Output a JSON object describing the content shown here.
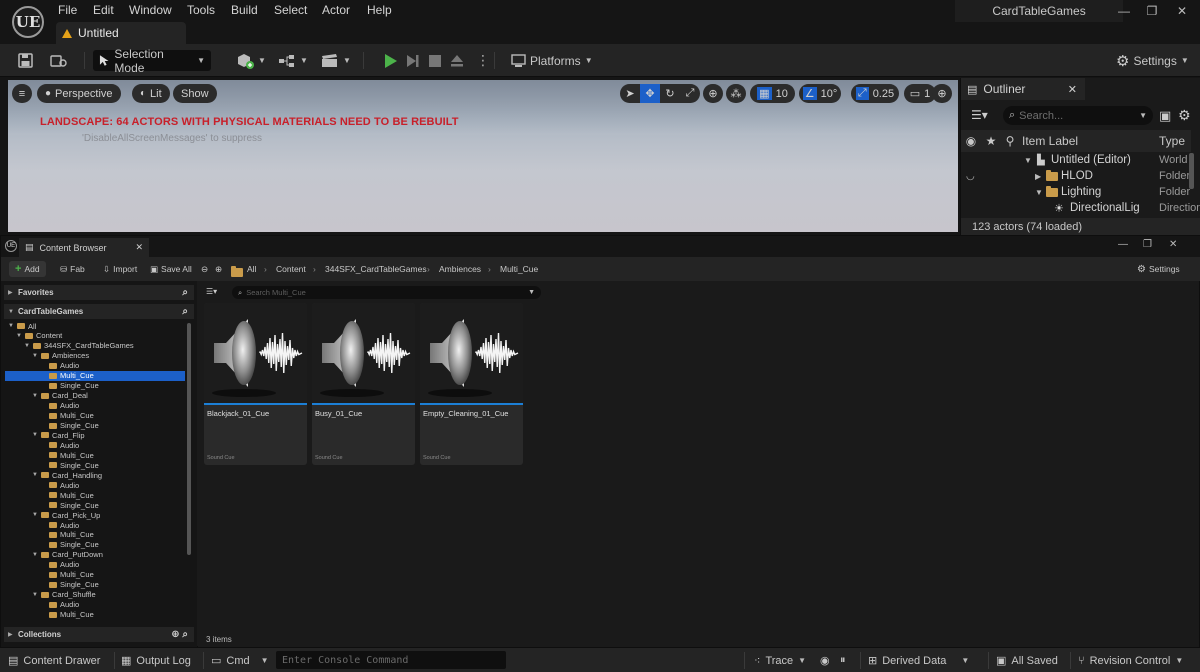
{
  "app": {
    "logo": "UE",
    "menu": [
      "File",
      "Edit",
      "Window",
      "Tools",
      "Build",
      "Select",
      "Actor",
      "Help"
    ],
    "document_tab": "Untitled",
    "project_name": "CardTableGames",
    "window_controls": {
      "minimize": "—",
      "maximize": "❐",
      "close": "✕"
    }
  },
  "toolbar": {
    "selection_mode": "Selection Mode",
    "platforms": "Platforms",
    "settings": "Settings"
  },
  "viewport": {
    "perspective": "Perspective",
    "lit": "Lit",
    "show": "Show",
    "grid_snap": "10",
    "rotation_snap": "10°",
    "scale_snap": "0.25",
    "camera_speed": "1",
    "warning": "LANDSCAPE: 64 ACTORS WITH PHYSICAL MATERIALS NEED TO BE REBUILT",
    "warning_hint": "'DisableAllScreenMessages' to suppress"
  },
  "outliner": {
    "tab": "Outliner",
    "search_placeholder": "Search...",
    "col_label": "Item Label",
    "col_type": "Type",
    "rows": [
      {
        "label": "Untitled (Editor)",
        "type": "World"
      },
      {
        "label": "HLOD",
        "type": "Folder"
      },
      {
        "label": "Lighting",
        "type": "Folder"
      },
      {
        "label": "DirectionalLig",
        "type": "Direction"
      }
    ],
    "status": "123 actors (74 loaded)"
  },
  "content_browser": {
    "tab": "Content Browser",
    "add": "Add",
    "fab": "Fab",
    "import": "Import",
    "save_all": "Save All",
    "breadcrumb": [
      "All",
      "Content",
      "344SFX_CardTableGames",
      "Ambiences",
      "Multi_Cue"
    ],
    "settings": "Settings",
    "favorites": "Favorites",
    "project_section": "CardTableGames",
    "collections": "Collections",
    "search_placeholder": "Search Multi_Cue",
    "tree": [
      {
        "label": "All",
        "indent": 0
      },
      {
        "label": "Content",
        "indent": 1
      },
      {
        "label": "344SFX_CardTableGames",
        "indent": 2
      },
      {
        "label": "Ambiences",
        "indent": 3
      },
      {
        "label": "Audio",
        "indent": 4
      },
      {
        "label": "Multi_Cue",
        "indent": 4,
        "selected": true
      },
      {
        "label": "Single_Cue",
        "indent": 4
      },
      {
        "label": "Card_Deal",
        "indent": 3
      },
      {
        "label": "Audio",
        "indent": 4
      },
      {
        "label": "Multi_Cue",
        "indent": 4
      },
      {
        "label": "Single_Cue",
        "indent": 4
      },
      {
        "label": "Card_Flip",
        "indent": 3
      },
      {
        "label": "Audio",
        "indent": 4
      },
      {
        "label": "Multi_Cue",
        "indent": 4
      },
      {
        "label": "Single_Cue",
        "indent": 4
      },
      {
        "label": "Card_Handling",
        "indent": 3
      },
      {
        "label": "Audio",
        "indent": 4
      },
      {
        "label": "Multi_Cue",
        "indent": 4
      },
      {
        "label": "Single_Cue",
        "indent": 4
      },
      {
        "label": "Card_Pick_Up",
        "indent": 3
      },
      {
        "label": "Audio",
        "indent": 4
      },
      {
        "label": "Multi_Cue",
        "indent": 4
      },
      {
        "label": "Single_Cue",
        "indent": 4
      },
      {
        "label": "Card_PutDown",
        "indent": 3
      },
      {
        "label": "Audio",
        "indent": 4
      },
      {
        "label": "Multi_Cue",
        "indent": 4
      },
      {
        "label": "Single_Cue",
        "indent": 4
      },
      {
        "label": "Card_Shuffle",
        "indent": 3
      },
      {
        "label": "Audio",
        "indent": 4
      },
      {
        "label": "Multi_Cue",
        "indent": 4
      }
    ],
    "assets": [
      {
        "name": "Blackjack_01_Cue",
        "type": "Sound Cue"
      },
      {
        "name": "Busy_01_Cue",
        "type": "Sound Cue"
      },
      {
        "name": "Empty_Cleaning_01_Cue",
        "type": "Sound Cue"
      }
    ],
    "item_count": "3 items"
  },
  "statusbar": {
    "content_drawer": "Content Drawer",
    "output_log": "Output Log",
    "cmd": "Cmd",
    "console_placeholder": "Enter Console Command",
    "trace": "Trace",
    "derived_data": "Derived Data",
    "all_saved": "All Saved",
    "revision_control": "Revision Control"
  },
  "colors": {
    "accent_blue": "#1c60c9",
    "play_green": "#4cb34a",
    "folder": "#c99b4a",
    "warning_red": "#c8202a"
  }
}
